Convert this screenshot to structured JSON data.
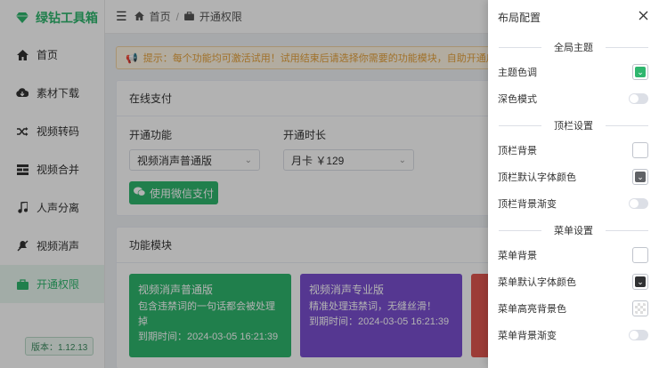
{
  "app": {
    "name": "绿钻工具箱",
    "version": "版本：1.12.13"
  },
  "sidebar": {
    "items": [
      {
        "label": "首页",
        "icon": "home-icon"
      },
      {
        "label": "素材下载",
        "icon": "cloud-download-icon"
      },
      {
        "label": "视频转码",
        "icon": "shuffle-icon"
      },
      {
        "label": "视频合并",
        "icon": "merge-icon"
      },
      {
        "label": "人声分离",
        "icon": "music-note-icon"
      },
      {
        "label": "视频消声",
        "icon": "mute-icon"
      },
      {
        "label": "开通权限",
        "icon": "briefcase-icon"
      }
    ]
  },
  "breadcrumb": {
    "home": "首页",
    "sep": "/",
    "current": "开通权限"
  },
  "notice": {
    "text": "提示：每个功能均可激活试用！试用结束后请选择你需要的功能模块，自助开通后可继续使用"
  },
  "payment": {
    "title": "在线支付",
    "feature_label": "开通功能",
    "feature_value": "视频消声普通版",
    "duration_label": "开通时长",
    "duration_value": "月卡 ￥129",
    "pay_button": "使用微信支付"
  },
  "modules": {
    "title": "功能模块",
    "tiles": [
      {
        "title": "视频消声普通版",
        "desc": "包含违禁词的一句话都会被处理掉",
        "expire": "到期时间：2024-03-05 16:21:39",
        "color": "#2fb66e"
      },
      {
        "title": "视频消声专业版",
        "desc": "精准处理违禁词，无缝丝滑！",
        "expire": "到期时间：2024-03-05 16:21:39",
        "color": "#7a4fd0"
      }
    ]
  },
  "drawer": {
    "title": "布局配置",
    "sections": [
      {
        "title": "全局主题",
        "rows": [
          {
            "label": "主题色调",
            "kind": "color",
            "color": "#2fb66e"
          },
          {
            "label": "深色模式",
            "kind": "toggle"
          }
        ]
      },
      {
        "title": "顶栏设置",
        "rows": [
          {
            "label": "顶栏背景",
            "kind": "color",
            "color": "#ffffff"
          },
          {
            "label": "顶栏默认字体颜色",
            "kind": "color",
            "color": "#606266"
          },
          {
            "label": "顶栏背景渐变",
            "kind": "toggle"
          }
        ]
      },
      {
        "title": "菜单设置",
        "rows": [
          {
            "label": "菜单背景",
            "kind": "color",
            "color": "#ffffff"
          },
          {
            "label": "菜单默认字体颜色",
            "kind": "color",
            "color": "#303133"
          },
          {
            "label": "菜单高亮背景色",
            "kind": "color",
            "color": "transparent"
          },
          {
            "label": "菜单背景渐变",
            "kind": "toggle"
          }
        ]
      }
    ]
  }
}
